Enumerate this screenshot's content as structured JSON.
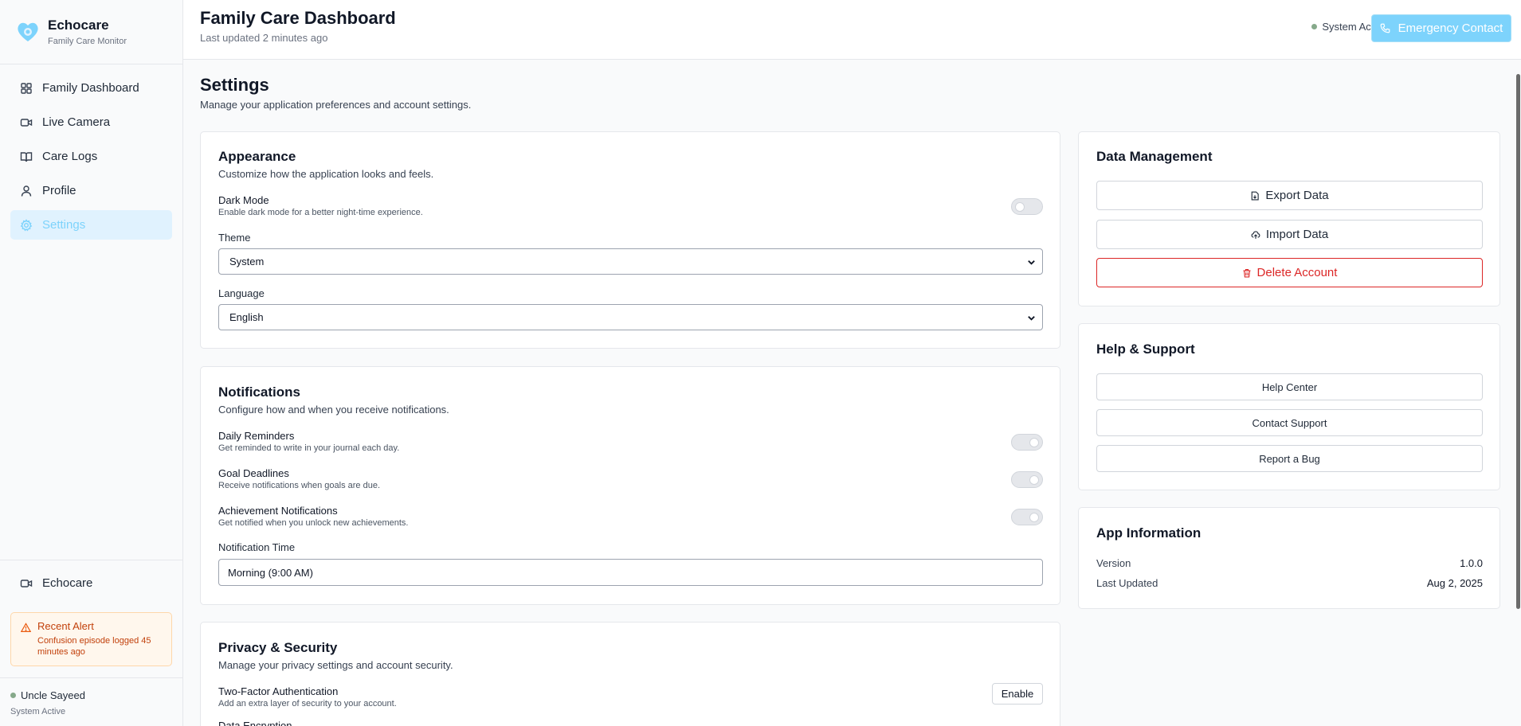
{
  "brand": {
    "name": "Echocare",
    "subtitle": "Family Care Monitor"
  },
  "sidebar": {
    "items": [
      {
        "label": "Family Dashboard",
        "icon": "grid-icon"
      },
      {
        "label": "Live Camera",
        "icon": "video-icon"
      },
      {
        "label": "Care Logs",
        "icon": "book-icon"
      },
      {
        "label": "Profile",
        "icon": "user-icon"
      },
      {
        "label": "Settings",
        "icon": "gear-icon",
        "active": true
      }
    ],
    "bottom_item": "Echocare",
    "alert": {
      "title": "Recent Alert",
      "text": "Confusion episode logged 45 minutes ago"
    },
    "user": {
      "name": "Uncle Sayeed",
      "status": "System Active"
    }
  },
  "header": {
    "title": "Family Care Dashboard",
    "subtitle": "Last updated 2 minutes ago",
    "status": "System Active",
    "emergency_label": "Emergency Contact"
  },
  "page": {
    "title": "Settings",
    "subtitle": "Manage your application preferences and account settings."
  },
  "appearance": {
    "title": "Appearance",
    "desc": "Customize how the application looks and feels.",
    "dark_mode": {
      "label": "Dark Mode",
      "hint": "Enable dark mode for a better night-time experience.",
      "enabled": false
    },
    "theme": {
      "label": "Theme",
      "value": "System"
    },
    "language": {
      "label": "Language",
      "value": "English"
    }
  },
  "notifications": {
    "title": "Notifications",
    "desc": "Configure how and when you receive notifications.",
    "items": [
      {
        "label": "Daily Reminders",
        "hint": "Get reminded to write in your journal each day.",
        "enabled": true
      },
      {
        "label": "Goal Deadlines",
        "hint": "Receive notifications when goals are due.",
        "enabled": true
      },
      {
        "label": "Achievement Notifications",
        "hint": "Get notified when you unlock new achievements.",
        "enabled": true
      }
    ],
    "time": {
      "label": "Notification Time",
      "value": "Morning (9:00 AM)"
    }
  },
  "privacy": {
    "title": "Privacy & Security",
    "desc": "Manage your privacy settings and account security.",
    "two_factor": {
      "label": "Two-Factor Authentication",
      "hint": "Add an extra layer of security to your account.",
      "button": "Enable"
    },
    "next_label": "Data Encryption"
  },
  "data_management": {
    "title": "Data Management",
    "export": "Export Data",
    "import": "Import Data",
    "delete": "Delete Account"
  },
  "help": {
    "title": "Help & Support",
    "help_center": "Help Center",
    "contact": "Contact Support",
    "bug": "Report a Bug"
  },
  "app_info": {
    "title": "App Information",
    "version_label": "Version",
    "version": "1.0.0",
    "updated_label": "Last Updated",
    "updated": "Aug 2, 2025"
  },
  "colors": {
    "accent": "#7dd3fc",
    "active_bg": "#e0f2fe",
    "danger": "#dc2626",
    "alert_bg": "#fff7ed",
    "alert_text": "#c2410c"
  }
}
